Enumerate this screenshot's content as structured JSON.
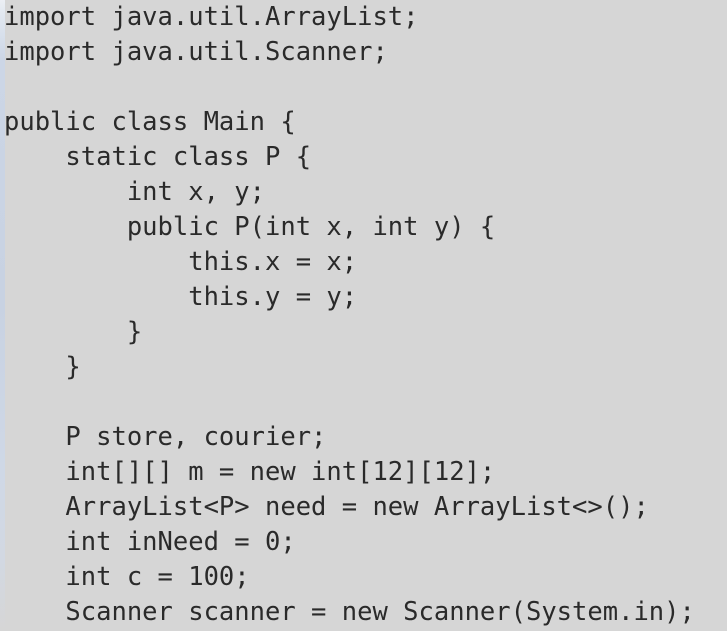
{
  "editor": {
    "language": "java",
    "background_color": "#d6d6d6",
    "text_color": "#2a2a2a",
    "left_edge_color": "#c8d2e2",
    "font": "monospace",
    "indent_unit_spaces": 4,
    "visible_line_count": 18,
    "last_line_clipped": true
  },
  "code": {
    "lines": [
      {
        "index": 1,
        "text": "import java.util.ArrayList;",
        "indent": 0,
        "blank": false
      },
      {
        "index": 2,
        "text": "import java.util.Scanner;",
        "indent": 0,
        "blank": false
      },
      {
        "index": 3,
        "text": "",
        "indent": 0,
        "blank": true
      },
      {
        "index": 4,
        "text": "public class Main {",
        "indent": 0,
        "blank": false
      },
      {
        "index": 5,
        "text": "    static class P {",
        "indent": 1,
        "blank": false
      },
      {
        "index": 6,
        "text": "        int x, y;",
        "indent": 2,
        "blank": false
      },
      {
        "index": 7,
        "text": "        public P(int x, int y) {",
        "indent": 2,
        "blank": false
      },
      {
        "index": 8,
        "text": "            this.x = x;",
        "indent": 3,
        "blank": false
      },
      {
        "index": 9,
        "text": "            this.y = y;",
        "indent": 3,
        "blank": false
      },
      {
        "index": 10,
        "text": "        }",
        "indent": 2,
        "blank": false
      },
      {
        "index": 11,
        "text": "    }",
        "indent": 1,
        "blank": false
      },
      {
        "index": 12,
        "text": "",
        "indent": 0,
        "blank": true
      },
      {
        "index": 13,
        "text": "    P store, courier;",
        "indent": 1,
        "blank": false
      },
      {
        "index": 14,
        "text": "    int[][] m = new int[12][12];",
        "indent": 1,
        "blank": false
      },
      {
        "index": 15,
        "text": "    ArrayList<P> need = new ArrayList<>();",
        "indent": 1,
        "blank": false
      },
      {
        "index": 16,
        "text": "    int inNeed = 0;",
        "indent": 1,
        "blank": false
      },
      {
        "index": 17,
        "text": "    int c = 100;",
        "indent": 1,
        "blank": false
      },
      {
        "index": 18,
        "text": "    Scanner scanner = new Scanner(System.in);",
        "indent": 1,
        "blank": false
      }
    ]
  }
}
